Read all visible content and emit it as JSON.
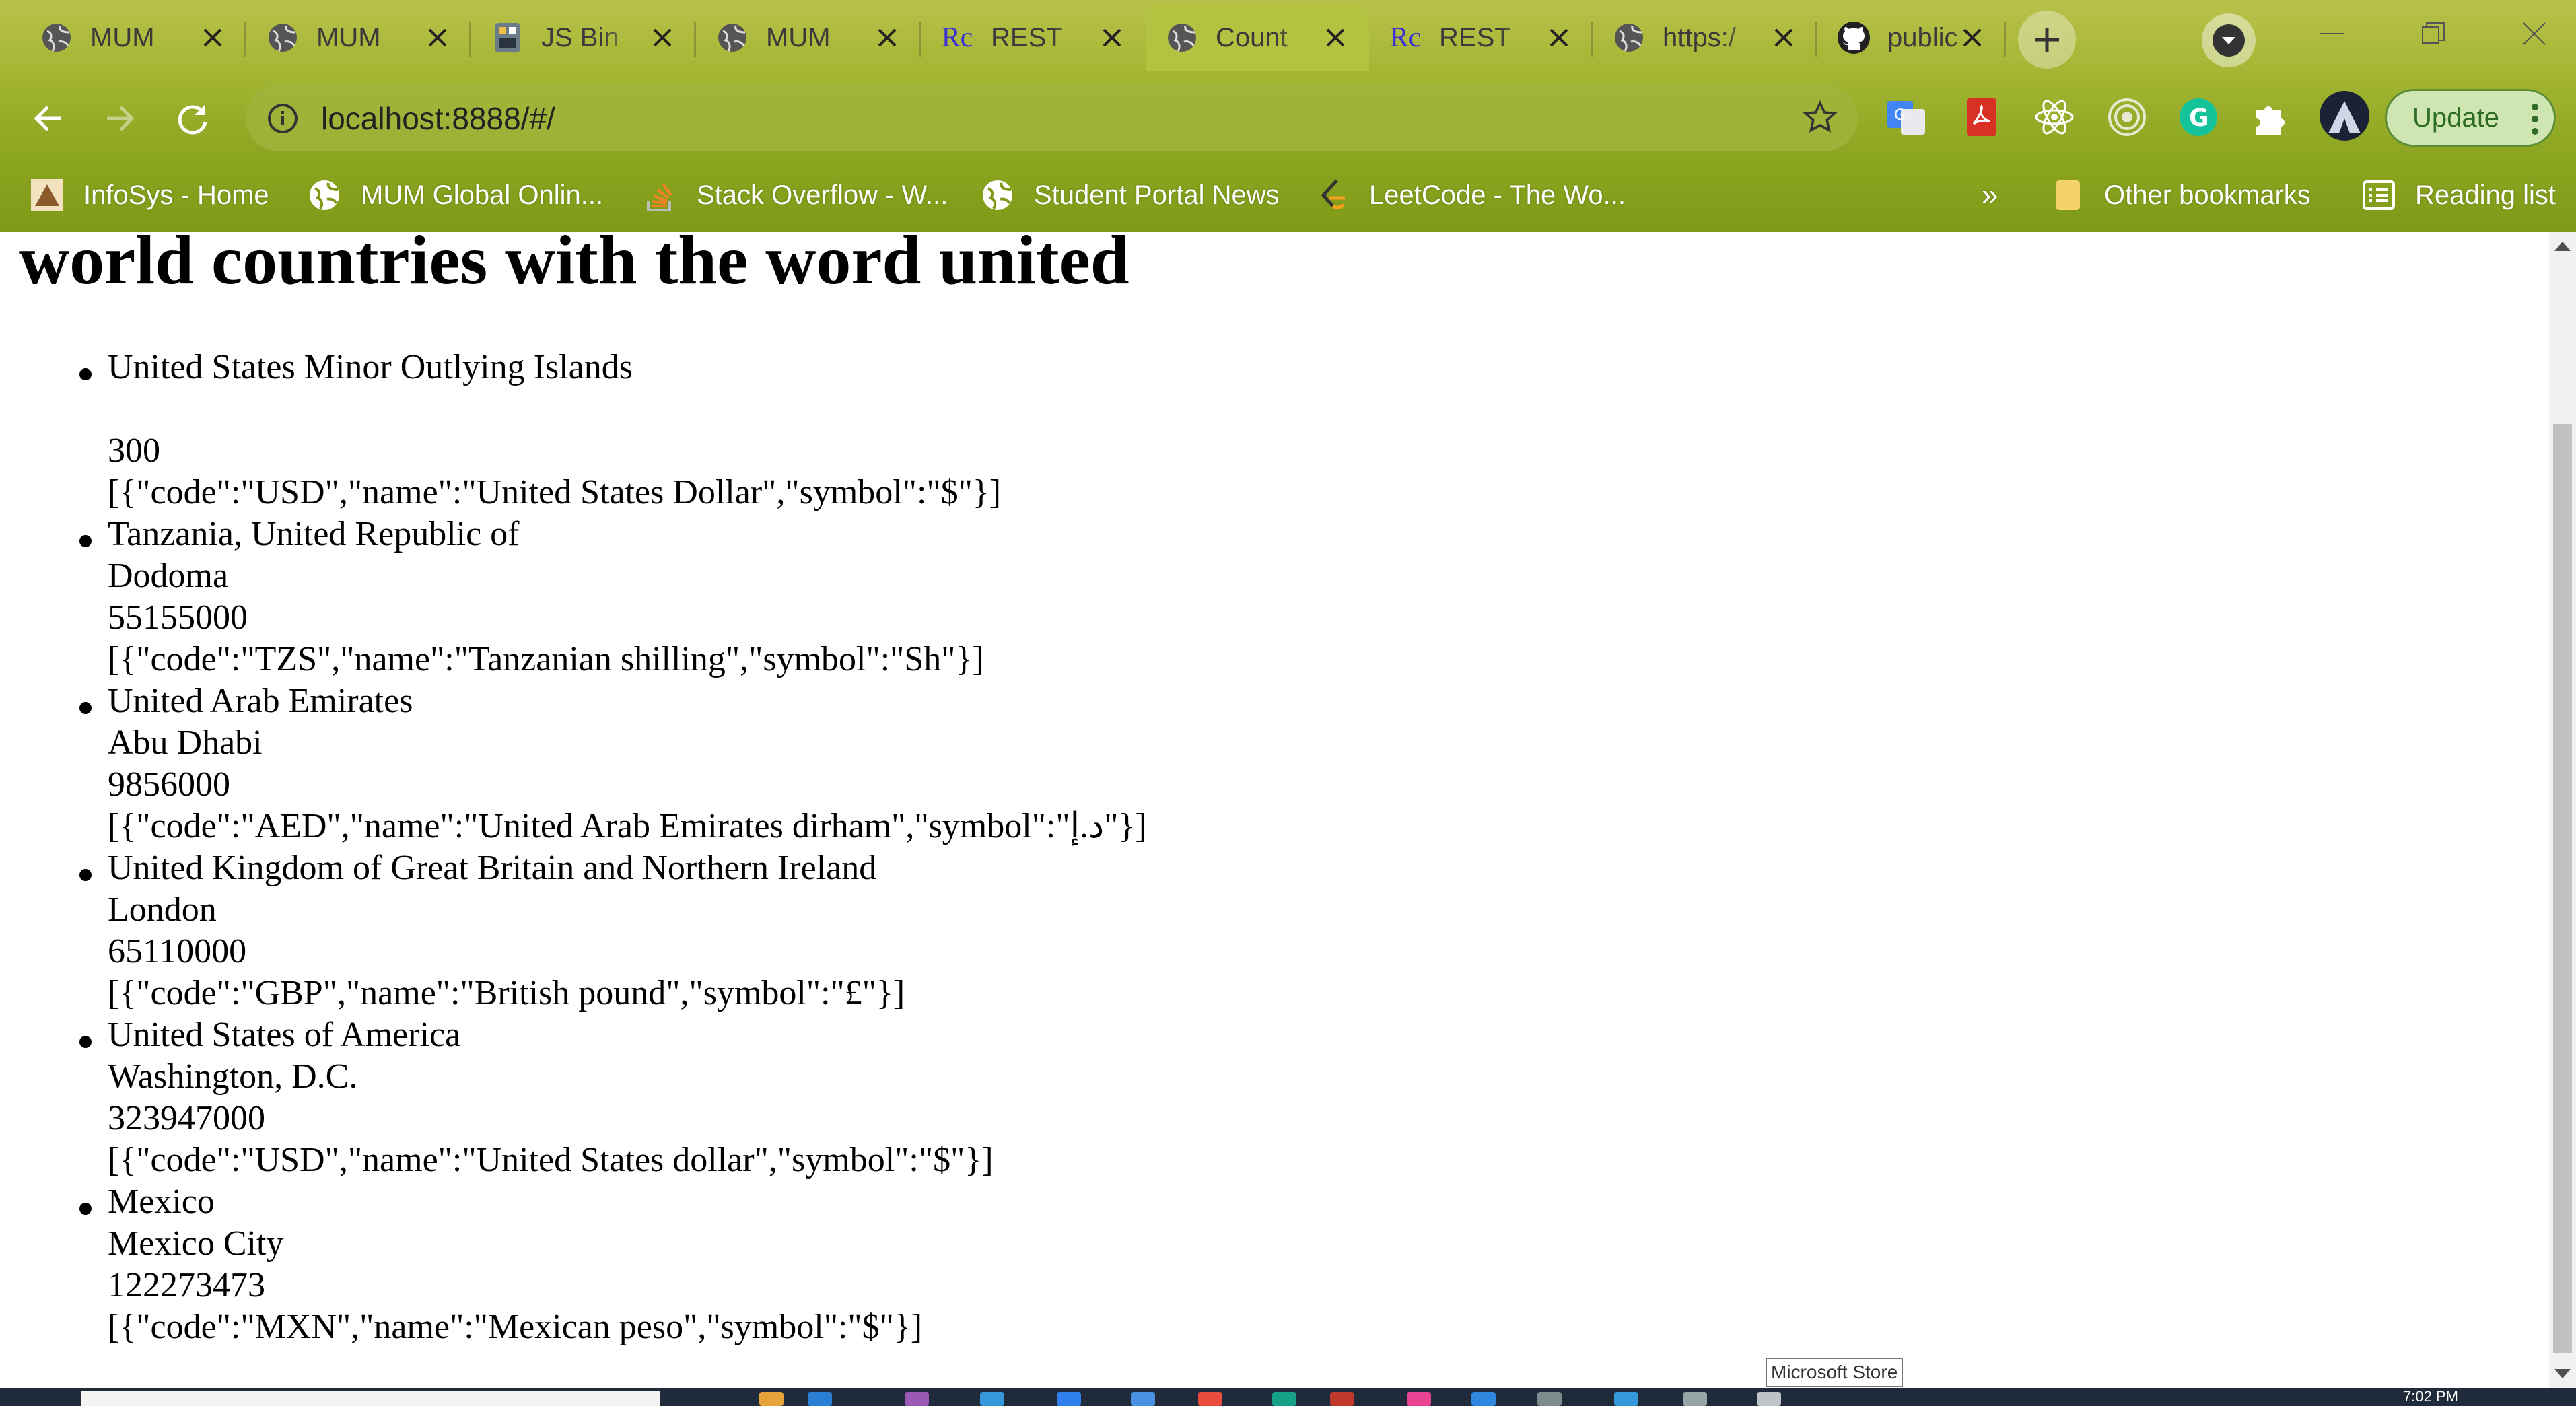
{
  "browser": {
    "tabs": [
      {
        "title": "MUM",
        "favicon": "globe-icon",
        "active": false
      },
      {
        "title": "MUM",
        "favicon": "globe-icon",
        "active": false
      },
      {
        "title": "JS Bin",
        "favicon": "jsbin-icon",
        "active": false
      },
      {
        "title": "MUM",
        "favicon": "globe-icon",
        "active": false
      },
      {
        "title": "REST",
        "favicon": "rc-icon",
        "active": false
      },
      {
        "title": "Count",
        "favicon": "globe-icon",
        "active": true
      },
      {
        "title": "REST",
        "favicon": "rc-icon",
        "active": false
      },
      {
        "title": "https:/",
        "favicon": "globe-icon",
        "active": false
      },
      {
        "title": "public",
        "favicon": "github-icon",
        "active": false
      }
    ],
    "url": "localhost:8888/#/",
    "update_label": "Update",
    "favicon_rc_text": "Rc",
    "bookmarks": [
      {
        "label": "InfoSys - Home"
      },
      {
        "label": "MUM Global Onlin..."
      },
      {
        "label": "Stack Overflow - W..."
      },
      {
        "label": "Student Portal News"
      },
      {
        "label": "LeetCode - The Wo..."
      }
    ],
    "more_bookmarks": "»",
    "other_bookmarks": "Other bookmarks",
    "reading_list": "Reading list"
  },
  "page": {
    "heading": "world countries with the word united",
    "countries": [
      {
        "name": "United States Minor Outlying Islands",
        "capital": "",
        "population": "300",
        "currencies": "[{\"code\":\"USD\",\"name\":\"United States Dollar\",\"symbol\":\"$\"}]"
      },
      {
        "name": "Tanzania, United Republic of",
        "capital": "Dodoma",
        "population": "55155000",
        "currencies": "[{\"code\":\"TZS\",\"name\":\"Tanzanian shilling\",\"symbol\":\"Sh\"}]"
      },
      {
        "name": "United Arab Emirates",
        "capital": "Abu Dhabi",
        "population": "9856000",
        "currencies": "[{\"code\":\"AED\",\"name\":\"United Arab Emirates dirham\",\"symbol\":\"د.إ\"}]"
      },
      {
        "name": "United Kingdom of Great Britain and Northern Ireland",
        "capital": "London",
        "population": "65110000",
        "currencies": "[{\"code\":\"GBP\",\"name\":\"British pound\",\"symbol\":\"£\"}]"
      },
      {
        "name": "United States of America",
        "capital": "Washington, D.C.",
        "population": "323947000",
        "currencies": "[{\"code\":\"USD\",\"name\":\"United States dollar\",\"symbol\":\"$\"}]"
      },
      {
        "name": "Mexico",
        "capital": "Mexico City",
        "population": "122273473",
        "currencies": "[{\"code\":\"MXN\",\"name\":\"Mexican peso\",\"symbol\":\"$\"}]"
      }
    ]
  },
  "tooltip": "Microsoft Store",
  "taskbar": {
    "clock": "7:02 PM"
  }
}
